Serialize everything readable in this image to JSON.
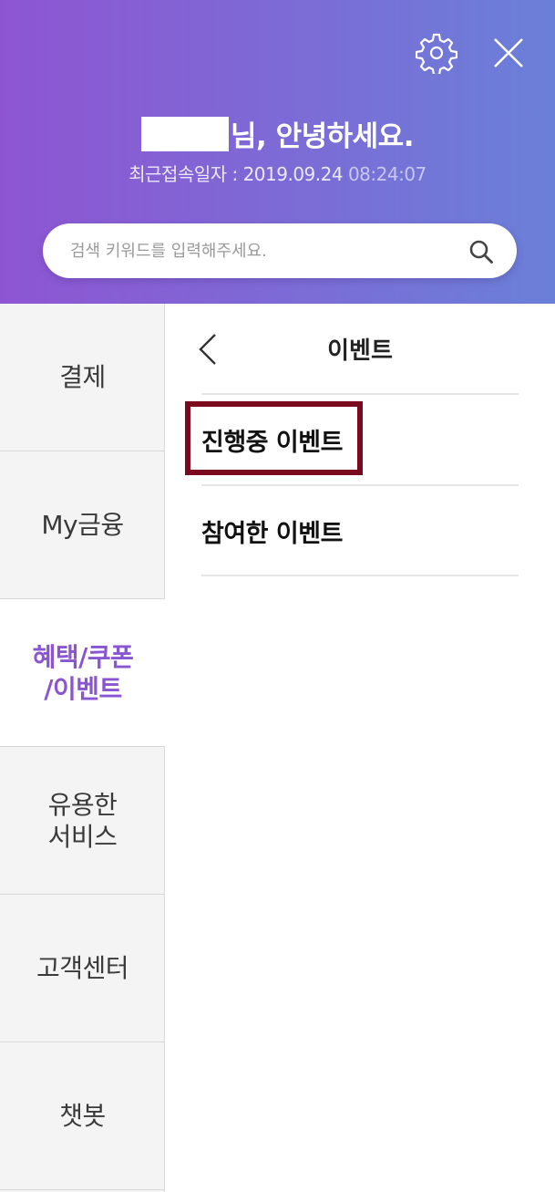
{
  "header": {
    "greeting": "님, 안녕하세요.",
    "last_login_label": "최근접속일자 : 2019.09.24",
    "last_login_time": "08:24:07",
    "settings_icon": "gear-icon",
    "close_icon": "close-icon"
  },
  "search": {
    "placeholder": "검색 키워드를 입력해주세요.",
    "value": "",
    "icon": "search-icon"
  },
  "sidebar": {
    "items": [
      {
        "label": "결제",
        "active": false
      },
      {
        "label": "My금융",
        "active": false
      },
      {
        "label": "혜택/쿠폰\n/이벤트",
        "active": true
      },
      {
        "label": "유용한\n서비스",
        "active": false
      },
      {
        "label": "고객센터",
        "active": false
      },
      {
        "label": "챗봇",
        "active": false
      }
    ]
  },
  "panel": {
    "back_icon": "chevron-left-icon",
    "title": "이벤트",
    "items": [
      {
        "label": "진행중 이벤트",
        "highlighted": true
      },
      {
        "label": "참여한 이벤트",
        "highlighted": false
      }
    ]
  },
  "colors": {
    "header_gradient_start": "#8e55d2",
    "header_gradient_end": "#6a80d8",
    "active_menu": "#8a55d1",
    "highlight_border": "#7b0a1e",
    "sidebar_bg": "#f4f4f4"
  }
}
